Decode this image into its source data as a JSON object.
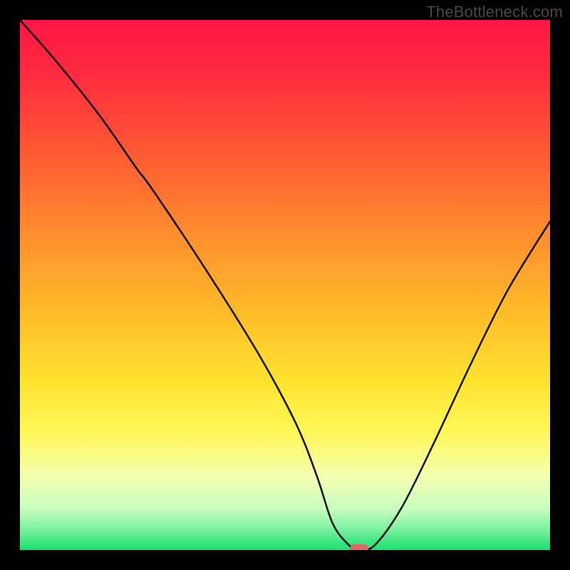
{
  "watermark": "TheBottleneck.com",
  "chart_data": {
    "type": "line",
    "title": "",
    "xlabel": "",
    "ylabel": "",
    "xlim": [
      0,
      100
    ],
    "ylim": [
      0,
      100
    ],
    "grid": false,
    "legend": false,
    "background": "vertical-gradient red→orange→yellow→green with black border",
    "series": [
      {
        "name": "bottleneck-curve",
        "x": [
          0,
          7,
          15,
          22,
          25,
          35,
          45,
          52,
          56,
          59,
          62,
          64,
          67,
          72,
          78,
          85,
          92,
          100
        ],
        "y": [
          100,
          92,
          82,
          72,
          68,
          53,
          37,
          24,
          14,
          5,
          1,
          0,
          1,
          8,
          20,
          35,
          49,
          62
        ]
      }
    ],
    "marker": {
      "x": 64,
      "y": 0,
      "color": "#e06666",
      "shape": "rounded-pill"
    }
  },
  "gradient_stops": [
    {
      "offset": 0.0,
      "color": "#ff1744"
    },
    {
      "offset": 0.1,
      "color": "#ff2a3f"
    },
    {
      "offset": 0.25,
      "color": "#ff5a33"
    },
    {
      "offset": 0.4,
      "color": "#ff8c2e"
    },
    {
      "offset": 0.55,
      "color": "#ffbb2a"
    },
    {
      "offset": 0.68,
      "color": "#ffe32e"
    },
    {
      "offset": 0.78,
      "color": "#fff85a"
    },
    {
      "offset": 0.86,
      "color": "#f6ffb0"
    },
    {
      "offset": 0.92,
      "color": "#c9ffbf"
    },
    {
      "offset": 0.96,
      "color": "#7cf2a0"
    },
    {
      "offset": 1.0,
      "color": "#18e06e"
    }
  ]
}
